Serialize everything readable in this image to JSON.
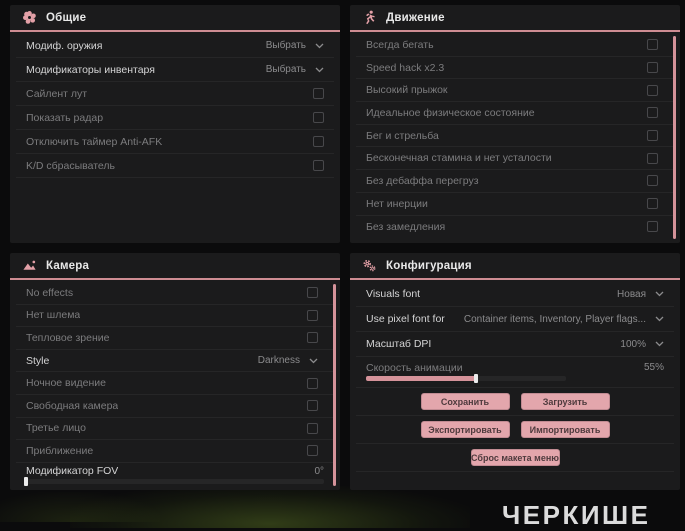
{
  "colors": {
    "accent": "#d5939a",
    "panel_bg": "#1b1b1c",
    "page_bg": "#0b0b0c",
    "button_bg": "#e3a6ac",
    "button_text": "#4e3a3d"
  },
  "panels": {
    "general": {
      "title": "Общие",
      "icon": "flower-gear-icon",
      "rows": [
        {
          "label": "Модиф. оружия",
          "control": "dropdown",
          "value": "Выбрать",
          "emphasis": "bright"
        },
        {
          "label": "Модификаторы инвентаря",
          "control": "dropdown",
          "value": "Выбрать",
          "emphasis": "bright"
        },
        {
          "label": "Сайлент лут",
          "control": "checkbox",
          "checked": false,
          "emphasis": "dim"
        },
        {
          "label": "Показать радар",
          "control": "checkbox",
          "checked": false,
          "emphasis": "dim"
        },
        {
          "label": "Отключить таймер Anti-AFK",
          "control": "checkbox",
          "checked": false,
          "emphasis": "dim"
        },
        {
          "label": "K/D сбрасыватель",
          "control": "checkbox",
          "checked": false,
          "emphasis": "dim"
        }
      ]
    },
    "movement": {
      "title": "Движение",
      "icon": "runner-icon",
      "rows": [
        {
          "label": "Всегда бегать",
          "control": "checkbox",
          "checked": false,
          "emphasis": "dim"
        },
        {
          "label": "Speed hack x2.3",
          "control": "checkbox",
          "checked": false,
          "emphasis": "dim"
        },
        {
          "label": "Высокий прыжок",
          "control": "checkbox",
          "checked": false,
          "emphasis": "dim"
        },
        {
          "label": "Идеальное физическое состояние",
          "control": "checkbox",
          "checked": false,
          "emphasis": "dim"
        },
        {
          "label": "Бег и стрельба",
          "control": "checkbox",
          "checked": false,
          "emphasis": "dim"
        },
        {
          "label": "Бесконечная стамина и нет усталости",
          "control": "checkbox",
          "checked": false,
          "emphasis": "dim"
        },
        {
          "label": "Без дебаффа перегруз",
          "control": "checkbox",
          "checked": false,
          "emphasis": "dim"
        },
        {
          "label": "Нет инерции",
          "control": "checkbox",
          "checked": false,
          "emphasis": "dim"
        },
        {
          "label": "Без замедления",
          "control": "checkbox",
          "checked": false,
          "emphasis": "dim"
        }
      ]
    },
    "camera": {
      "title": "Камера",
      "icon": "image-icon",
      "rows": [
        {
          "label": "No effects",
          "control": "checkbox",
          "checked": false,
          "emphasis": "dim"
        },
        {
          "label": "Нет шлема",
          "control": "checkbox",
          "checked": false,
          "emphasis": "dim"
        },
        {
          "label": "Тепловое зрение",
          "control": "checkbox",
          "checked": false,
          "emphasis": "dim"
        },
        {
          "label": "Style",
          "control": "dropdown",
          "value": "Darkness",
          "emphasis": "bright"
        },
        {
          "label": "Ночное видение",
          "control": "checkbox",
          "checked": false,
          "emphasis": "dim"
        },
        {
          "label": "Свободная камера",
          "control": "checkbox",
          "checked": false,
          "emphasis": "dim"
        },
        {
          "label": "Третье лицо",
          "control": "checkbox",
          "checked": false,
          "emphasis": "dim"
        },
        {
          "label": "Приближение",
          "control": "checkbox",
          "checked": false,
          "emphasis": "dim"
        },
        {
          "label": "Модификатор FOV",
          "control": "slider",
          "value": "0°",
          "percent": 0,
          "emphasis": "bright"
        }
      ]
    },
    "config": {
      "title": "Конфигурация",
      "icon": "gears-icon",
      "rows": [
        {
          "label": "Visuals font",
          "control": "dropdown",
          "value": "Новая",
          "emphasis": "bright"
        },
        {
          "label": "Use pixel font for",
          "control": "dropdown",
          "value": "Container items, Inventory, Player flags...",
          "emphasis": "bright"
        },
        {
          "label": "Масштаб DPI",
          "control": "dropdown",
          "value": "100%",
          "emphasis": "bright"
        },
        {
          "label": "Скорость анимации",
          "control": "slider",
          "value": "55%",
          "percent": 55,
          "track_width": 200,
          "emphasis": "dim"
        }
      ],
      "buttons": [
        {
          "label": "Сохранить",
          "name": "save-button",
          "row": 0
        },
        {
          "label": "Загрузить",
          "name": "load-button",
          "row": 0
        },
        {
          "label": "Экспортировать",
          "name": "export-button",
          "row": 1
        },
        {
          "label": "Импортировать",
          "name": "import-button",
          "row": 1
        },
        {
          "label": "Сброс макета меню",
          "name": "reset-menu-layout-button",
          "row": 2
        }
      ]
    }
  },
  "watermark": "ЧЕРКИШЕ"
}
